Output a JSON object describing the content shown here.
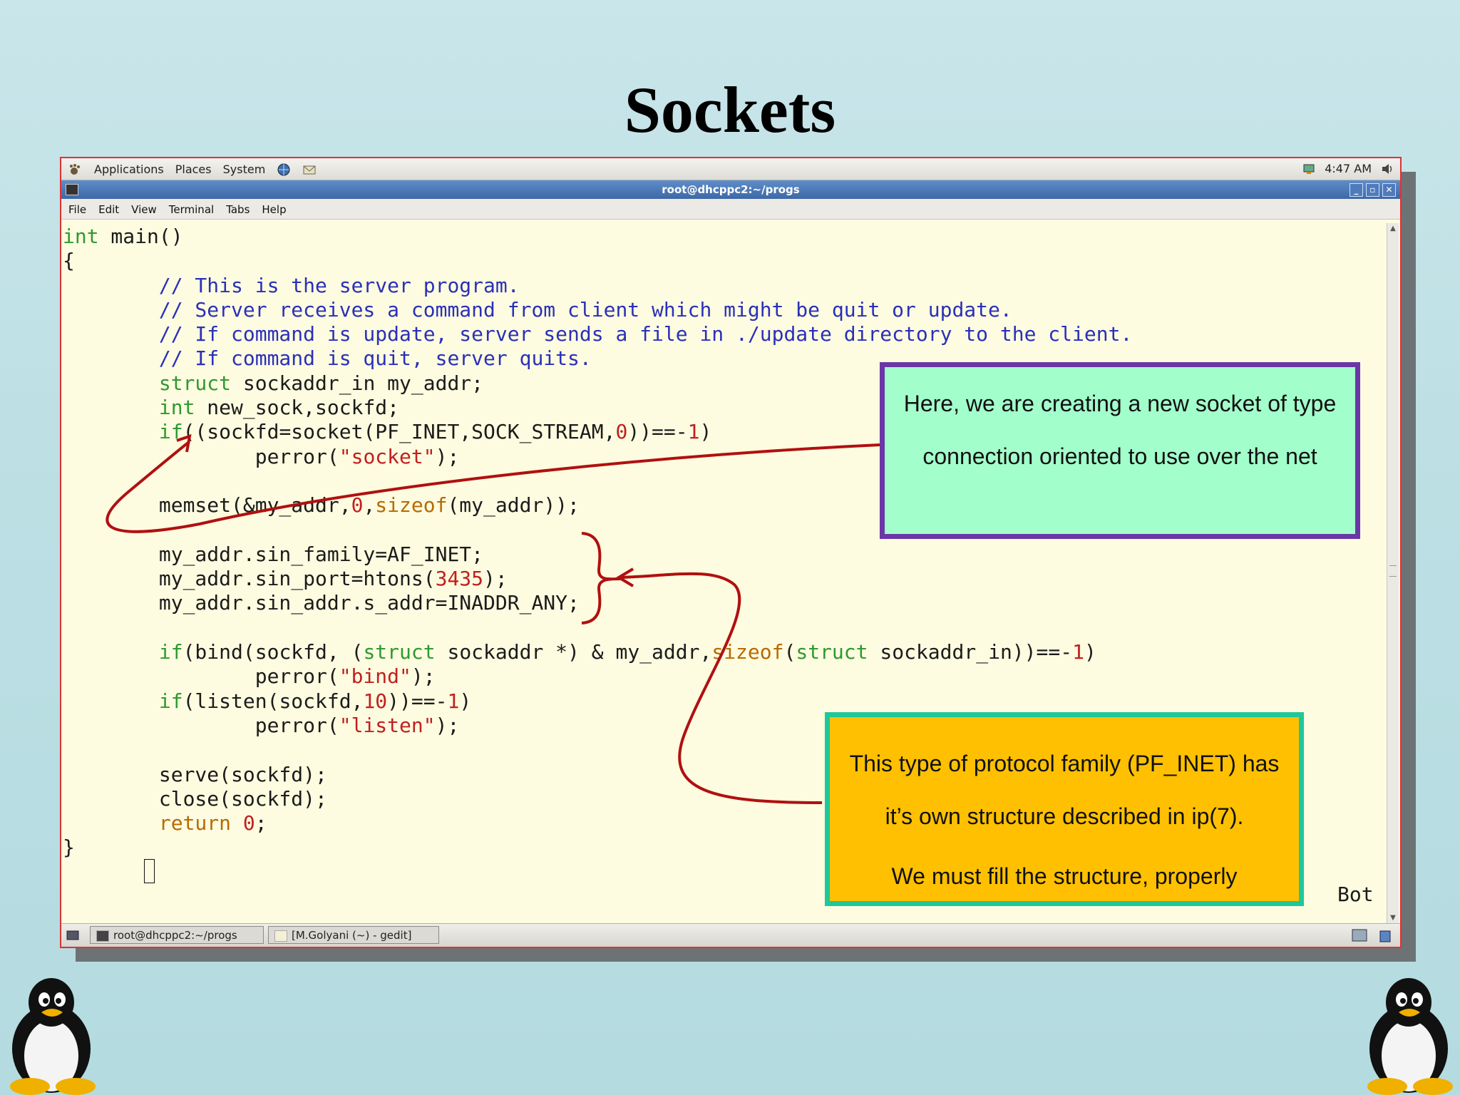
{
  "slide": {
    "title": "Sockets"
  },
  "top_panel": {
    "applications": "Applications",
    "places": "Places",
    "system": "System",
    "clock": "4:47 AM"
  },
  "window": {
    "title": "root@dhcppc2:~/progs",
    "menu": [
      "File",
      "Edit",
      "View",
      "Terminal",
      "Tabs",
      "Help"
    ]
  },
  "editor": {
    "status": "Bot",
    "code_lines": [
      [
        [
          "kw",
          "int"
        ],
        [
          "p",
          " main()"
        ]
      ],
      [
        [
          "p",
          "{"
        ]
      ],
      [
        [
          "p",
          "        "
        ],
        [
          "cm",
          "// This is the server program."
        ]
      ],
      [
        [
          "p",
          "        "
        ],
        [
          "cm",
          "// Server receives a command from client which might be quit or update."
        ]
      ],
      [
        [
          "p",
          "        "
        ],
        [
          "cm",
          "// If command is update, server sends a file in ./update directory to the client."
        ]
      ],
      [
        [
          "p",
          "        "
        ],
        [
          "cm",
          "// If command is quit, server quits."
        ]
      ],
      [
        [
          "p",
          "        "
        ],
        [
          "kw",
          "struct"
        ],
        [
          "p",
          " sockaddr_in my_addr;"
        ]
      ],
      [
        [
          "p",
          "        "
        ],
        [
          "kw",
          "int"
        ],
        [
          "p",
          " new_sock,sockfd;"
        ]
      ],
      [
        [
          "p",
          "        "
        ],
        [
          "kw",
          "if"
        ],
        [
          "p",
          "((sockfd=socket(PF_INET,SOCK_STREAM,"
        ],
        [
          "num",
          "0"
        ],
        [
          "p",
          "))==-"
        ],
        [
          "num",
          "1"
        ],
        [
          "p",
          ")"
        ]
      ],
      [
        [
          "p",
          "                perror("
        ],
        [
          "str",
          "\"socket\""
        ],
        [
          "p",
          ");"
        ]
      ],
      [
        [
          "p",
          ""
        ]
      ],
      [
        [
          "p",
          "        memset(&my_addr,"
        ],
        [
          "num",
          "0"
        ],
        [
          "p",
          ","
        ],
        [
          "ty",
          "sizeof"
        ],
        [
          "p",
          "(my_addr));"
        ]
      ],
      [
        [
          "p",
          ""
        ]
      ],
      [
        [
          "p",
          "        my_addr.sin_family=AF_INET;"
        ]
      ],
      [
        [
          "p",
          "        my_addr.sin_port=htons("
        ],
        [
          "num",
          "3435"
        ],
        [
          "p",
          ");"
        ]
      ],
      [
        [
          "p",
          "        my_addr.sin_addr.s_addr=INADDR_ANY;"
        ]
      ],
      [
        [
          "p",
          ""
        ]
      ],
      [
        [
          "p",
          "        "
        ],
        [
          "kw",
          "if"
        ],
        [
          "p",
          "(bind(sockfd, ("
        ],
        [
          "kw",
          "struct"
        ],
        [
          "p",
          " sockaddr *) & my_addr,"
        ],
        [
          "ty",
          "sizeof"
        ],
        [
          "p",
          "("
        ],
        [
          "kw",
          "struct"
        ],
        [
          "p",
          " sockaddr_in))==-"
        ],
        [
          "num",
          "1"
        ],
        [
          "p",
          ")"
        ]
      ],
      [
        [
          "p",
          "                perror("
        ],
        [
          "str",
          "\"bind\""
        ],
        [
          "p",
          ");"
        ]
      ],
      [
        [
          "p",
          "        "
        ],
        [
          "kw",
          "if"
        ],
        [
          "p",
          "(listen(sockfd,"
        ],
        [
          "num",
          "10"
        ],
        [
          "p",
          "))==-"
        ],
        [
          "num",
          "1"
        ],
        [
          "p",
          ")"
        ]
      ],
      [
        [
          "p",
          "                perror("
        ],
        [
          "str",
          "\"listen\""
        ],
        [
          "p",
          ");"
        ]
      ],
      [
        [
          "p",
          ""
        ]
      ],
      [
        [
          "p",
          "        serve(sockfd);"
        ]
      ],
      [
        [
          "p",
          "        close(sockfd);"
        ]
      ],
      [
        [
          "p",
          "        "
        ],
        [
          "ty",
          "return"
        ],
        [
          "p",
          " "
        ],
        [
          "num",
          "0"
        ],
        [
          "p",
          ";"
        ]
      ],
      [
        [
          "p",
          "}"
        ]
      ]
    ]
  },
  "callouts": {
    "socket_note": "Here, we are creating a new socket of type connection oriented to use over the net",
    "struct_note_line1": "This type of protocol family (PF_INET) has it’s own structure described in ip(7).",
    "struct_note_line2": "We must fill the structure, properly"
  },
  "taskbar": {
    "task1": "root@dhcppc2:~/progs",
    "task2": "[M.Golyani (~) - gedit]"
  },
  "colors": {
    "callout_green_bg": "#a2fecb",
    "callout_green_border": "#6b37a6",
    "callout_orange_bg": "#fec000",
    "callout_orange_border": "#1fc79a",
    "arrow_red": "#b01010",
    "titlebar_blue": "#4a76b5"
  },
  "icons": [
    "applications-foot-icon",
    "globe-icon",
    "mail-icon",
    "network-icon",
    "volume-icon",
    "terminal-icon",
    "gedit-icon",
    "show-desktop-icon",
    "penguin-icon"
  ]
}
